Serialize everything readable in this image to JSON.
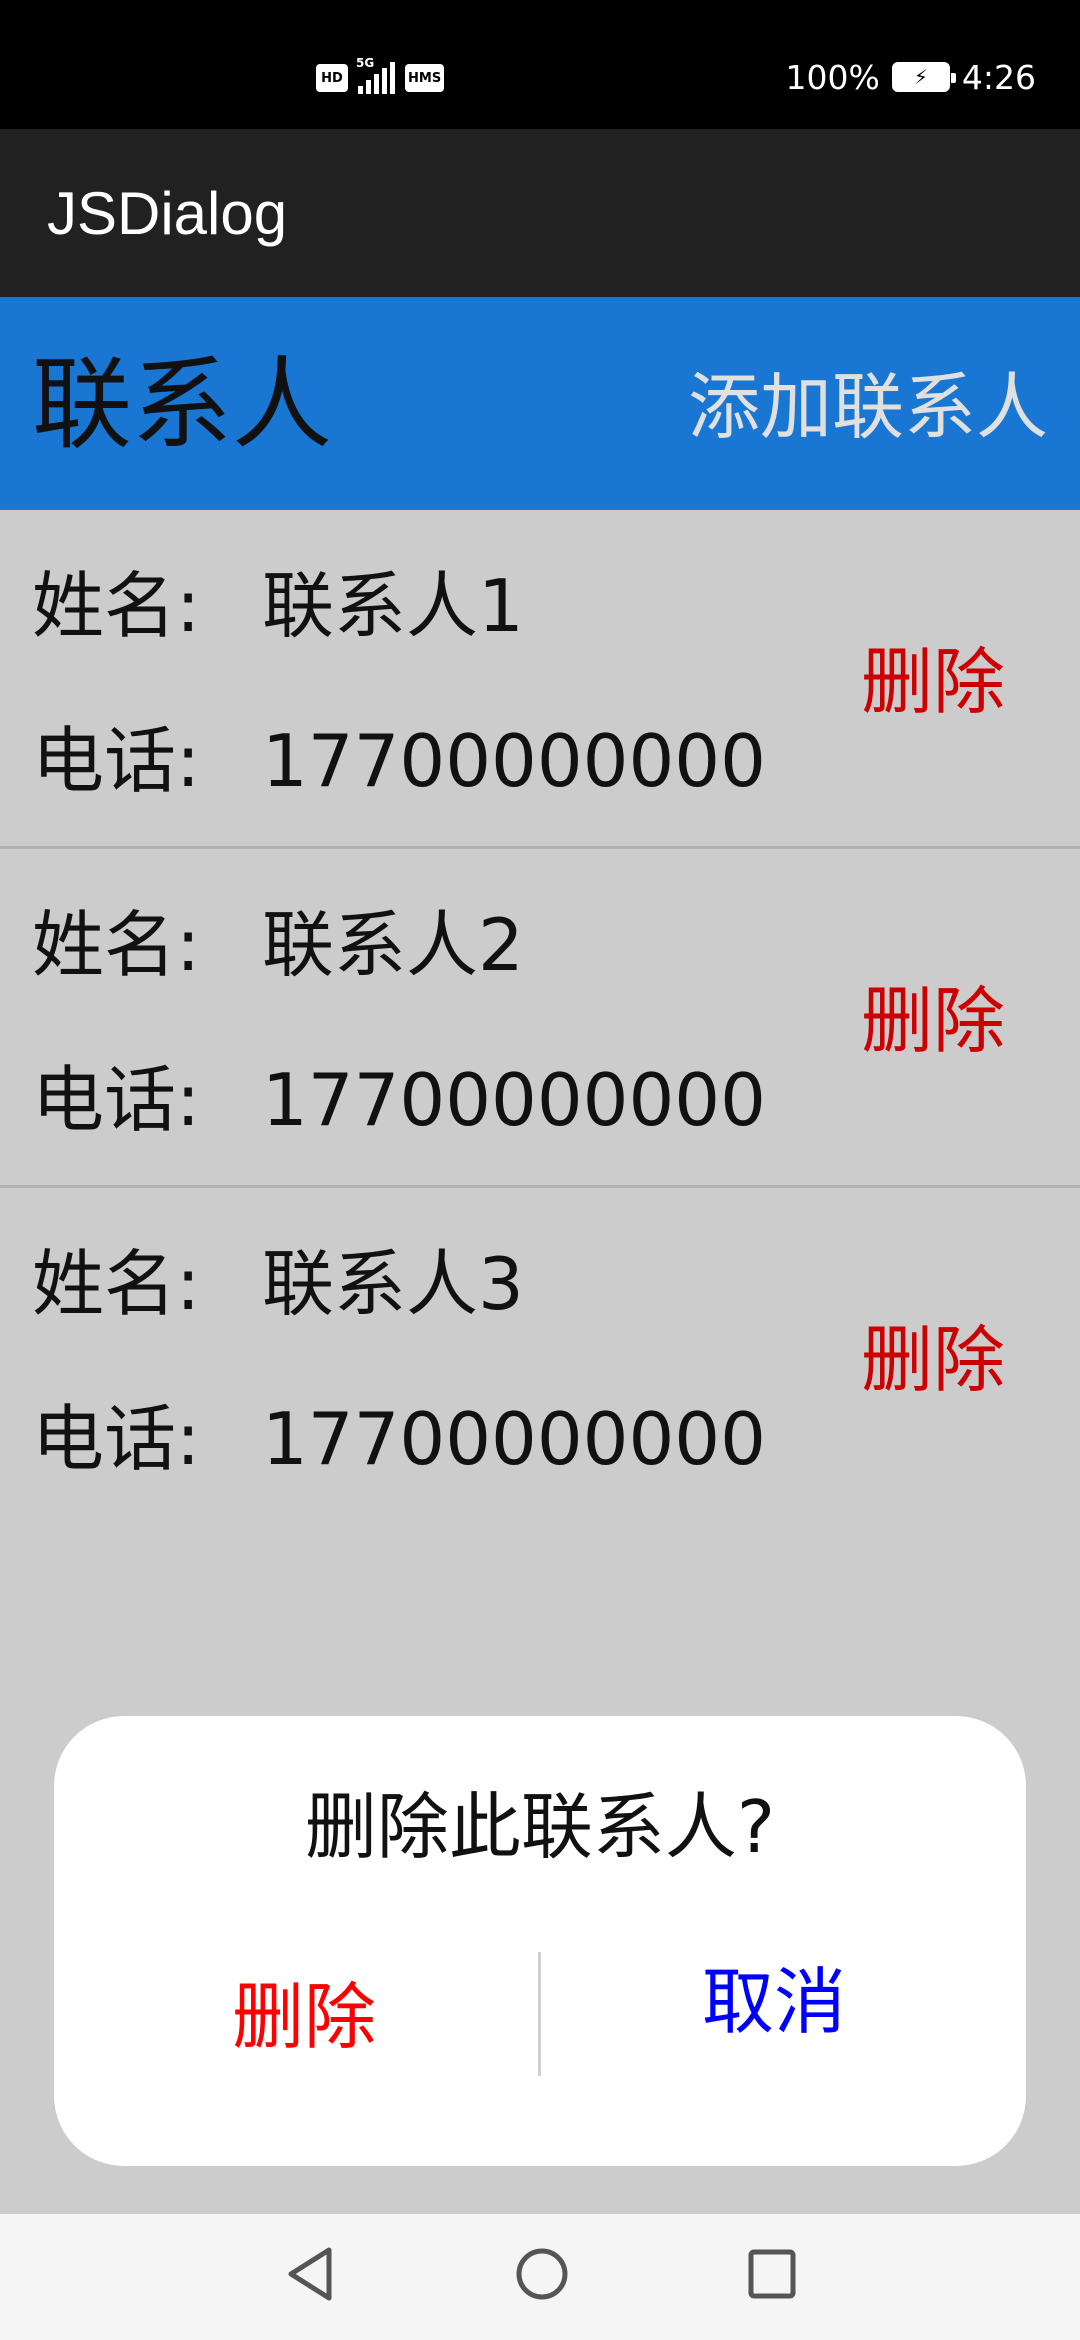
{
  "status_bar": {
    "hd_badge": "HD",
    "network": "5G",
    "hms_badge": "HMS",
    "battery": "100%",
    "time": "4:26"
  },
  "app_bar": {
    "title": "JSDialog"
  },
  "header": {
    "title": "联系人",
    "add_button": "添加联系人"
  },
  "contacts": [
    {
      "name_label": "姓名:",
      "name": "联系人1",
      "phone_label": "电话:",
      "phone": "17700000000",
      "delete": "删除"
    },
    {
      "name_label": "姓名:",
      "name": "联系人2",
      "phone_label": "电话:",
      "phone": "17700000000",
      "delete": "删除"
    },
    {
      "name_label": "姓名:",
      "name": "联系人3",
      "phone_label": "电话:",
      "phone": "17700000000",
      "delete": "删除"
    }
  ],
  "dialog": {
    "message": "删除此联系人?",
    "confirm_label": "删除",
    "cancel_label": "取消"
  },
  "colors": {
    "header_bg": "#1976d2",
    "app_bar_bg": "#212121",
    "delete_red": "#cc0000",
    "dialog_delete": "#ff0000",
    "dialog_cancel": "#0000ff"
  },
  "nav_icons": [
    "back-icon",
    "home-icon",
    "recent-apps-icon"
  ]
}
